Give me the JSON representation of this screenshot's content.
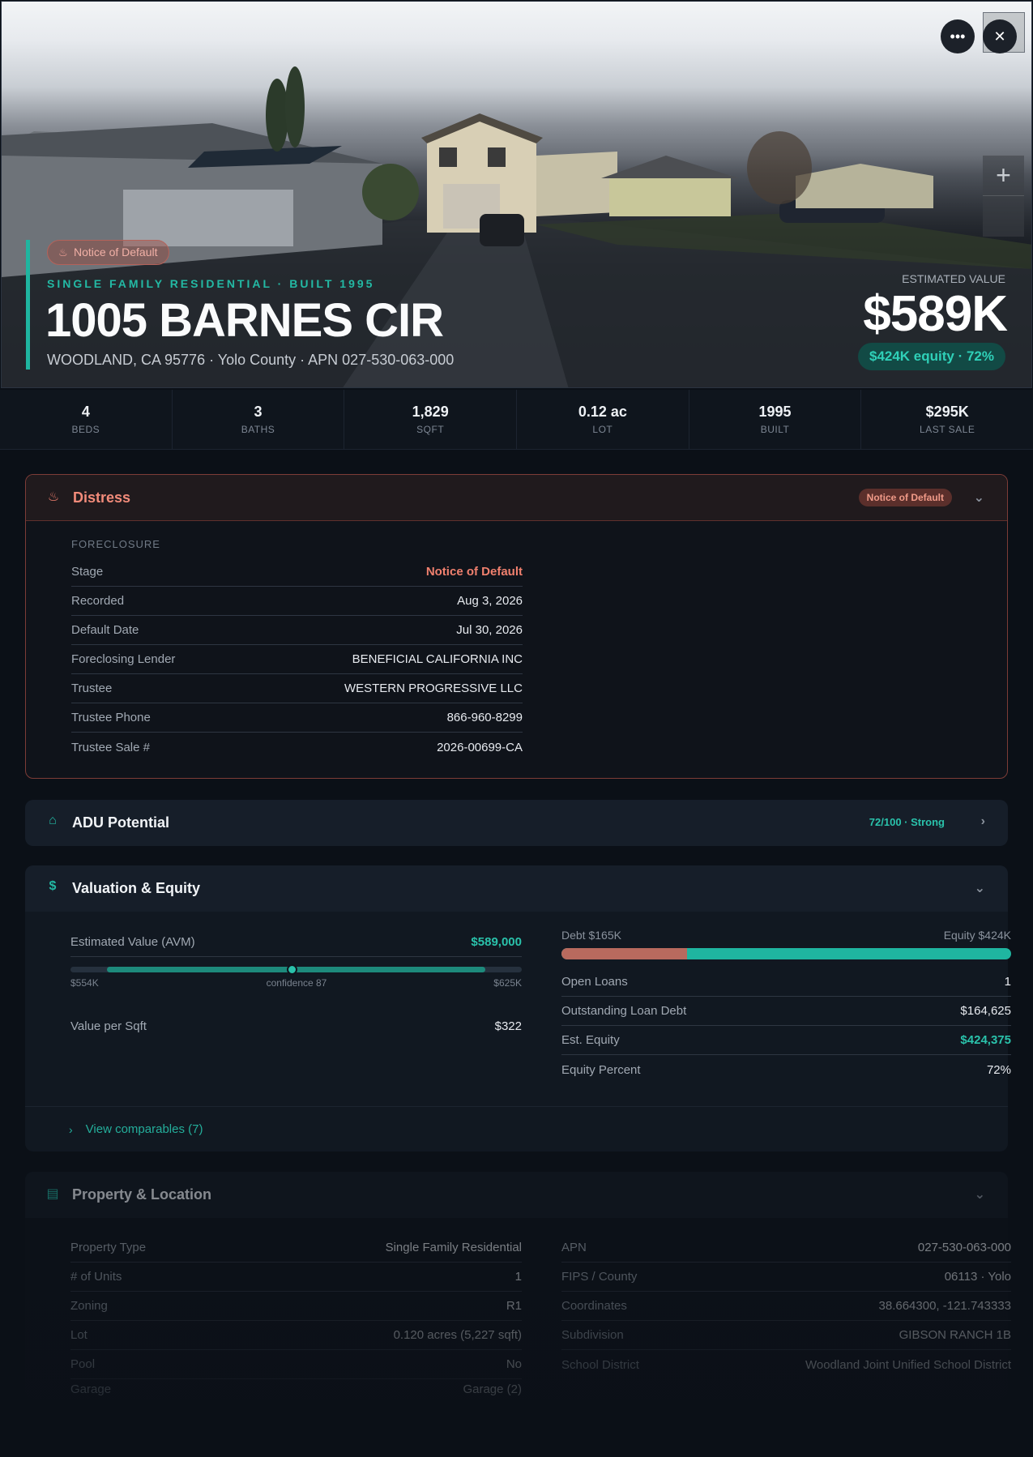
{
  "hero": {
    "badge": "Notice of Default",
    "subtitle": "SINGLE FAMILY RESIDENTIAL · BUILT 1995",
    "title": "1005 BARNES CIR",
    "address": "WOODLAND, CA 95776 · Yolo County · APN 027-530-063-000",
    "estimated_label": "ESTIMATED VALUE",
    "estimated_value": "$589K",
    "equity_pill": "$424K equity · 72%"
  },
  "stats": [
    {
      "value": "4",
      "label": "BEDS"
    },
    {
      "value": "3",
      "label": "BATHS"
    },
    {
      "value": "1,829",
      "label": "SQFT"
    },
    {
      "value": "0.12 ac",
      "label": "LOT"
    },
    {
      "value": "1995",
      "label": "BUILT"
    },
    {
      "value": "$295K",
      "label": "LAST SALE"
    }
  ],
  "distress": {
    "title": "Distress",
    "badge": "Notice of Default",
    "section": "FORECLOSURE",
    "rows": [
      {
        "k": "Stage",
        "v": "Notice of Default"
      },
      {
        "k": "Recorded",
        "v": "Aug 3, 2026"
      },
      {
        "k": "Default Date",
        "v": "Jul 30, 2026"
      },
      {
        "k": "Foreclosing Lender",
        "v": "BENEFICIAL CALIFORNIA INC"
      },
      {
        "k": "Trustee",
        "v": "WESTERN PROGRESSIVE LLC"
      },
      {
        "k": "Trustee Phone",
        "v": "866-960-8299"
      },
      {
        "k": "Trustee Sale #",
        "v": "2026-00699-CA"
      }
    ]
  },
  "adu": {
    "title": "ADU Potential",
    "score": "72/100 · Strong"
  },
  "valuation": {
    "title": "Valuation & Equity",
    "avm_label": "Estimated Value (AVM)",
    "avm_value": "$589,000",
    "range_low": "$554K",
    "range_high": "$625K",
    "confidence": "confidence 87",
    "range_position": 0.49,
    "per_sqft_label": "Value per Sqft",
    "per_sqft_value": "$322",
    "debt_label": "Debt $165K",
    "equity_label": "Equity $424K",
    "debt_fraction": 0.28,
    "rows": [
      {
        "k": "Open Loans",
        "v": "1"
      },
      {
        "k": "Outstanding Loan Debt",
        "v": "$164,625"
      },
      {
        "k": "Est. Equity",
        "v": "$424,375"
      },
      {
        "k": "Equity Percent",
        "v": "72%"
      }
    ],
    "comparables": "View comparables (7)"
  },
  "property": {
    "title": "Property & Location",
    "left": [
      {
        "k": "Property Type",
        "v": "Single Family Residential"
      },
      {
        "k": "# of Units",
        "v": "1"
      },
      {
        "k": "Zoning",
        "v": "R1"
      },
      {
        "k": "Lot",
        "v": "0.120 acres (5,227 sqft)"
      },
      {
        "k": "Pool",
        "v": "No"
      },
      {
        "k": "Garage",
        "v": "Garage (2)"
      }
    ],
    "right": [
      {
        "k": "APN",
        "v": "027-530-063-000"
      },
      {
        "k": "FIPS / County",
        "v": "06113 · Yolo"
      },
      {
        "k": "Coordinates",
        "v": "38.664300, -121.743333"
      },
      {
        "k": "Subdivision",
        "v": "GIBSON RANCH 1B"
      },
      {
        "k": "School District",
        "v": "Woodland Joint Unified School District"
      }
    ]
  },
  "icons": {
    "more": "more-horizontal-icon",
    "close": "close-icon",
    "zoom_in": "plus-icon",
    "flame": "flame-icon",
    "home": "home-icon",
    "dollar": "dollar-icon",
    "building": "building-icon",
    "chevron": "chevron-down-icon"
  }
}
